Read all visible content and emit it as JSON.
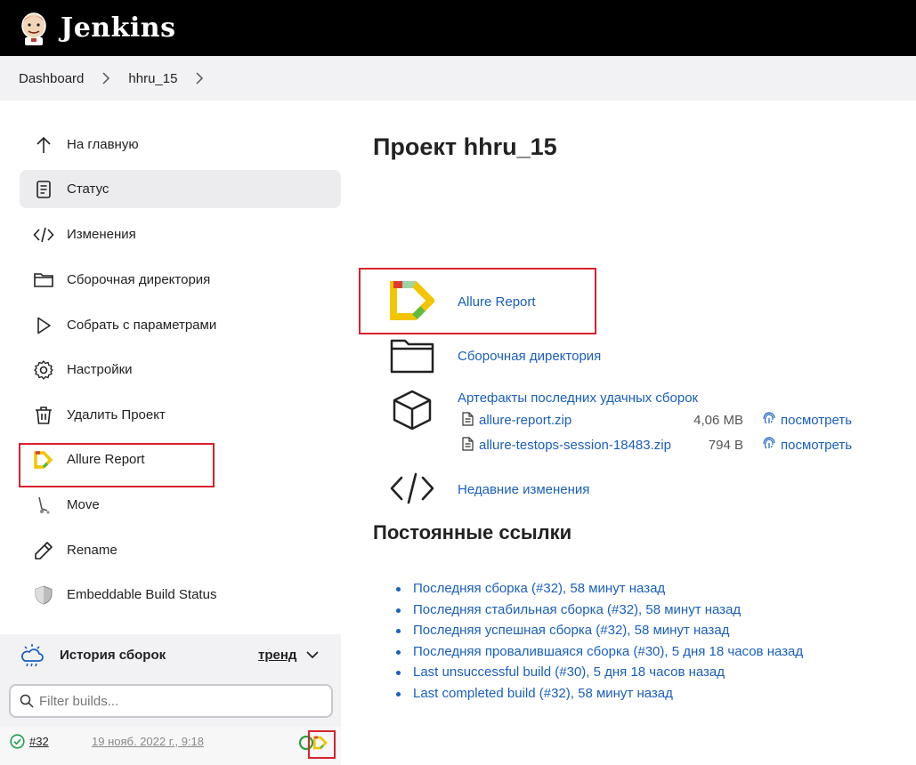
{
  "header": {
    "brand": "Jenkins"
  },
  "breadcrumb": {
    "items": [
      "Dashboard",
      "hhru_15"
    ]
  },
  "sidebar": {
    "items": [
      {
        "label": "На главную",
        "icon": "arrow-up-icon"
      },
      {
        "label": "Статус",
        "icon": "document-icon"
      },
      {
        "label": "Изменения",
        "icon": "code-icon"
      },
      {
        "label": "Сборочная директория",
        "icon": "folder-icon"
      },
      {
        "label": "Собрать с параметрами",
        "icon": "play-icon"
      },
      {
        "label": "Настройки",
        "icon": "gear-icon"
      },
      {
        "label": "Удалить Проект",
        "icon": "trash-icon"
      },
      {
        "label": "Allure Report",
        "icon": "allure-icon"
      },
      {
        "label": "Move",
        "icon": "move-icon"
      },
      {
        "label": "Rename",
        "icon": "pencil-icon"
      },
      {
        "label": "Embeddable Build Status",
        "icon": "shield-icon"
      }
    ],
    "active_item": "Статус"
  },
  "build_history": {
    "title": "История сборок",
    "trend": "тренд",
    "filter_placeholder": "Filter builds...",
    "builds": [
      {
        "number": "#32",
        "date": "19 нояб. 2022 г., 9:18",
        "status": "success"
      }
    ]
  },
  "main": {
    "title": "Проект hhru_15",
    "actions": {
      "allure": "Allure Report",
      "workspace": "Сборочная директория",
      "artifacts_title": "Артефакты последних удачных сборок",
      "changes": "Недавние изменения"
    },
    "artifacts": [
      {
        "name": "allure-report.zip",
        "size": "4,06 MB",
        "view": "посмотреть"
      },
      {
        "name": "allure-testops-session-18483.zip",
        "size": "794 B",
        "view": "посмотреть"
      }
    ],
    "permalinks_title": "Постоянные ссылки",
    "permalinks": [
      "Последняя сборка (#32), 58 минут назад",
      "Последняя стабильная сборка (#32), 58 минут назад",
      "Последняя успешная сборка (#32), 58 минут назад",
      "Последняя провалившаяся сборка (#30), 5 дня 18 часов назад",
      "Last unsuccessful build (#30), 5 дня 18 часов назад",
      "Last completed build (#32), 58 минут назад"
    ]
  },
  "colors": {
    "link": "#1a5fbf",
    "highlight_box": "#d8222c",
    "header_bg": "#000000"
  }
}
